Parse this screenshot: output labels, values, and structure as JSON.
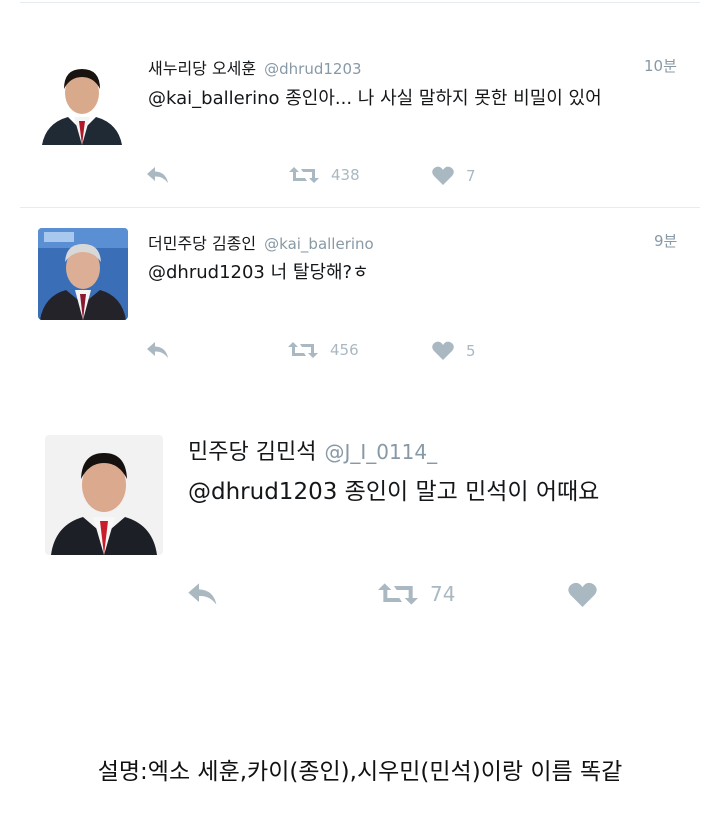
{
  "tweets": [
    {
      "display_name": "새누리당 오세훈",
      "handle": "@dhrud1203",
      "time": "10분",
      "text": "@kai_ballerino 종인아... 나 사실 말하지 못한 비밀이 있어",
      "retweets": "438",
      "likes": "7"
    },
    {
      "display_name": "더민주당 김종인",
      "handle": "@kai_ballerino",
      "time": "9분",
      "text": "@dhrud1203 너 탈당해?ㅎ",
      "retweets": "456",
      "likes": "5"
    },
    {
      "display_name": "민주당 김민석",
      "handle": "@J_I_0114_",
      "text": "@dhrud1203 종인이 말고 민석이 어때요",
      "retweets": "74"
    }
  ],
  "caption": "설명:엑소 세훈,카이(종인),시우민(민석)이랑 이름 똑같",
  "icons": [
    "reply-icon",
    "retweet-icon",
    "like-icon"
  ],
  "colors": {
    "icon": "#aab8c2",
    "handle": "#8899a6",
    "text": "#14171a",
    "divider": "#e6ecf0"
  }
}
